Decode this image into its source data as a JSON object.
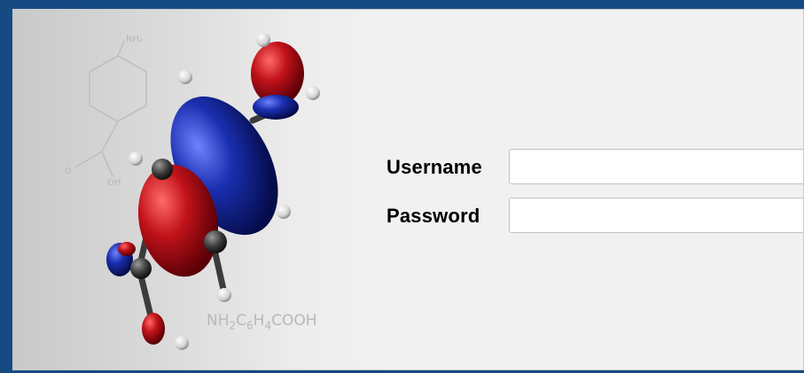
{
  "login": {
    "username_label": "Username",
    "password_label": "Password",
    "username_value": "",
    "password_value": ""
  },
  "artwork": {
    "formula_parts": [
      "NH",
      "2",
      "C",
      "6",
      "H",
      "4",
      "COOH"
    ],
    "sketch_label_top": "NH₂",
    "sketch_label_o": "O",
    "sketch_label_oh": "OH",
    "colors": {
      "lobe_red": "#c1121a",
      "lobe_blue": "#1a2fb0",
      "atom_carbon": "#3a3a3a",
      "atom_hydrogen": "#e6e6e6",
      "frame_blue": "#164a82"
    }
  }
}
